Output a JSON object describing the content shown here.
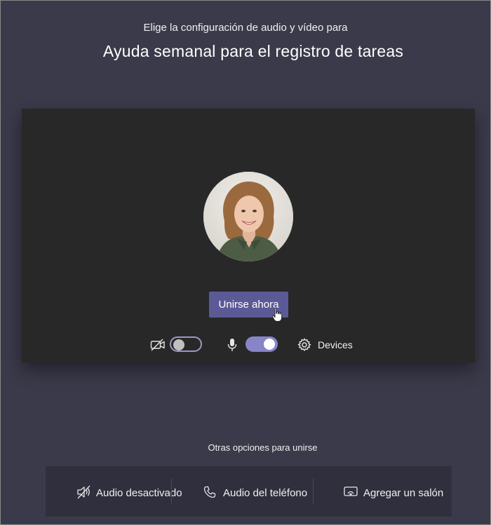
{
  "header": {
    "subtitle": "Elige la configuración de audio y vídeo para",
    "meeting_title": "Ayuda semanal para el registro de tareas"
  },
  "preview": {
    "join_button_label": "Unirse ahora",
    "camera_toggle_on": false,
    "mic_toggle_on": true,
    "devices_label": "Devices",
    "icons": [
      "camera-off-icon",
      "microphone-icon",
      "gear-icon",
      "hand-pointer-cursor"
    ]
  },
  "other_options": {
    "label": "Otras opciones para unirse",
    "items": [
      {
        "icon": "speaker-off-icon",
        "label": "Audio desactivado"
      },
      {
        "icon": "phone-icon",
        "label": "Audio del teléfono"
      },
      {
        "icon": "room-cast-icon",
        "label": "Agregar un salón"
      }
    ]
  },
  "colors": {
    "page_background": "#3b3a4a",
    "preview_background": "#282828",
    "accent": "#5c5a96",
    "toggle_on": "#8784c8"
  }
}
